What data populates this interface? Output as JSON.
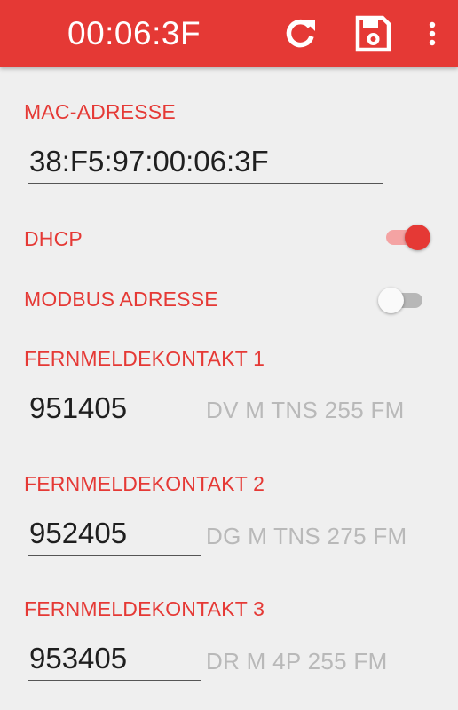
{
  "appbar": {
    "title": "00:06:3F",
    "refresh_icon": "refresh-icon",
    "save_icon": "save-icon",
    "more_icon": "more-vert-icon",
    "color": "#e53935"
  },
  "mac": {
    "label": "MAC-ADRESSE",
    "value": "38:F5:97:00:06:3F"
  },
  "dhcp": {
    "label": "DHCP",
    "enabled": true
  },
  "modbus": {
    "label": "MODBUS ADRESSE",
    "enabled": false
  },
  "contacts": [
    {
      "label": "FERNMELDEKONTAKT 1",
      "value": "951405",
      "hint": "DV M TNS 255 FM"
    },
    {
      "label": "FERNMELDEKONTAKT 2",
      "value": "952405",
      "hint": "DG M TNS 275 FM"
    },
    {
      "label": "FERNMELDEKONTAKT 3",
      "value": "953405",
      "hint": "DR M 4P 255 FM"
    }
  ]
}
